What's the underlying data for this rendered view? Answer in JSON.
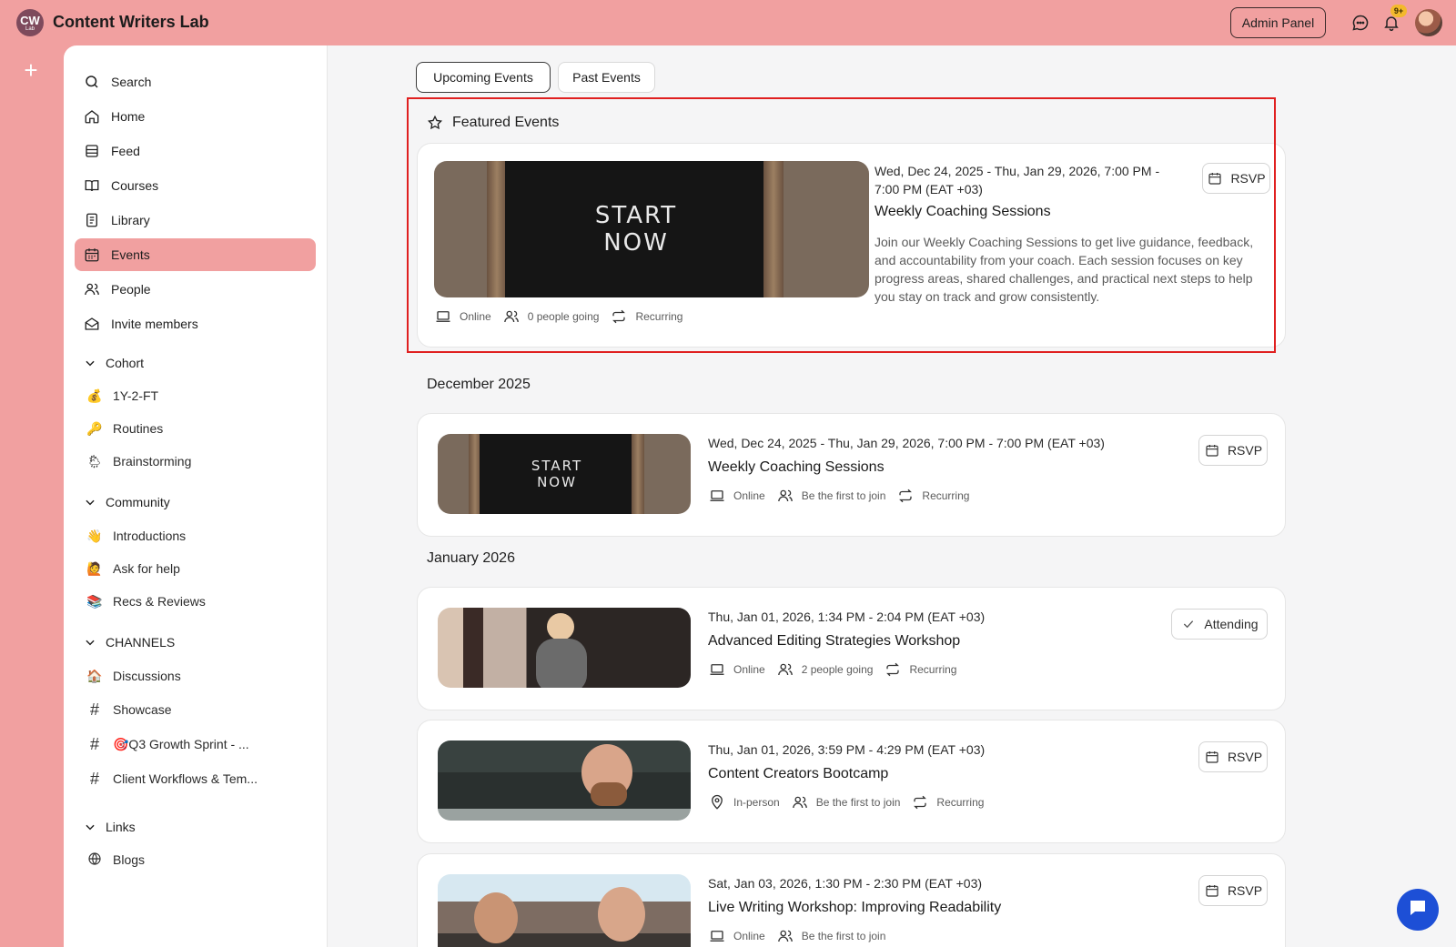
{
  "app": {
    "logo_big": "CW",
    "logo_small": "Lab",
    "title": "Content Writers Lab",
    "admin_label": "Admin Panel",
    "notif_badge": "9+"
  },
  "sidebar": {
    "nav": [
      {
        "label": "Search",
        "icon": "search-icon"
      },
      {
        "label": "Home",
        "icon": "home-icon"
      },
      {
        "label": "Feed",
        "icon": "feed-icon"
      },
      {
        "label": "Courses",
        "icon": "book-icon"
      },
      {
        "label": "Library",
        "icon": "library-icon"
      },
      {
        "label": "Events",
        "icon": "calendar-icon"
      },
      {
        "label": "People",
        "icon": "people-icon"
      },
      {
        "label": "Invite members",
        "icon": "envelope-icon"
      }
    ],
    "sections": {
      "cohort": {
        "label": "Cohort",
        "items": [
          {
            "emoji": "💰",
            "label": "1Y-2-FT"
          },
          {
            "emoji": "🔑",
            "label": "Routines"
          },
          {
            "emoji": "🌦",
            "label": "Brainstorming"
          }
        ]
      },
      "community": {
        "label": "Community",
        "items": [
          {
            "emoji": "👋",
            "label": "Introductions"
          },
          {
            "emoji": "🙋",
            "label": "Ask for help"
          },
          {
            "emoji": "📚",
            "label": "Recs & Reviews"
          }
        ]
      },
      "channels": {
        "label": "CHANNELS",
        "items": [
          {
            "emoji": "🏠",
            "label": "Discussions"
          },
          {
            "hash": "#",
            "label": "Showcase"
          },
          {
            "hash": "#",
            "label": "🎯Q3 Growth Sprint - ..."
          },
          {
            "hash": "#",
            "label": "Client Workflows & Tem..."
          }
        ]
      },
      "links": {
        "label": "Links",
        "items": [
          {
            "icon": "globe-icon",
            "label": "Blogs"
          }
        ]
      }
    }
  },
  "tabs": {
    "upcoming": "Upcoming Events",
    "past": "Past Events"
  },
  "featured": {
    "heading": "Featured Events",
    "event": {
      "date": "Wed, Dec 24, 2025 - Thu, Jan 29, 2026, 7:00 PM -",
      "date2": "7:00 PM (EAT +03)",
      "title": "Weekly Coaching Sessions",
      "description": "Join our Weekly Coaching Sessions to get live guidance, feedback, and accountability from your coach. Each session focuses on key progress areas, shared challenges, and practical next steps to help you stay on track and grow consistently.",
      "board_line1": "START",
      "board_line2": "NOW",
      "location": "Online",
      "going": "0 people going",
      "recurring": "Recurring",
      "action": "RSVP"
    }
  },
  "months": {
    "dec": "December 2025",
    "jan": "January 2026"
  },
  "events": [
    {
      "date": "Wed, Dec 24, 2025 - Thu, Jan 29, 2026, 7:00 PM - 7:00 PM (EAT +03)",
      "title": "Weekly Coaching Sessions",
      "location": "Online",
      "going": "Be the first to join",
      "recurring": "Recurring",
      "action": "RSVP",
      "board_line1": "START",
      "board_line2": "NOW"
    },
    {
      "date": "Thu, Jan 01, 2026, 1:34 PM - 2:04 PM (EAT +03)",
      "title": "Advanced Editing Strategies Workshop",
      "location": "Online",
      "going": "2 people going",
      "recurring": "Recurring",
      "action": "Attending"
    },
    {
      "date": "Thu, Jan 01, 2026, 3:59 PM - 4:29 PM (EAT +03)",
      "title": "Content Creators Bootcamp",
      "location": "In-person",
      "going": "Be the first to join",
      "recurring": "Recurring",
      "action": "RSVP"
    },
    {
      "date": "Sat, Jan 03, 2026, 1:30 PM - 2:30 PM (EAT +03)",
      "title": "Live Writing Workshop: Improving Readability",
      "location": "Online",
      "going": "Be the first to join",
      "action": "RSVP"
    }
  ],
  "colors": {
    "brand": "#f1a0a0",
    "highlight": "#e02020",
    "chat": "#1d4fd6"
  }
}
